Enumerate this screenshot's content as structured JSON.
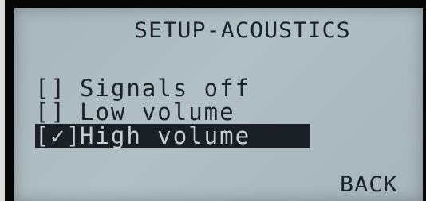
{
  "screen": {
    "title": "SETUP-ACOUSTICS",
    "items": [
      {
        "checkbox": "[]",
        "label": "Signals off",
        "checked": false,
        "selected": false
      },
      {
        "checkbox": "[]",
        "label": "Low volume",
        "checked": false,
        "selected": false
      },
      {
        "checkbox": "[✓]",
        "label": "High volume",
        "checked": true,
        "selected": true
      }
    ],
    "back_label": "BACK"
  },
  "colors": {
    "lcd_background": "#adbcc1",
    "lcd_text": "#1c2328",
    "highlight_background": "#1a2026",
    "highlight_text": "#c4cfd3"
  }
}
